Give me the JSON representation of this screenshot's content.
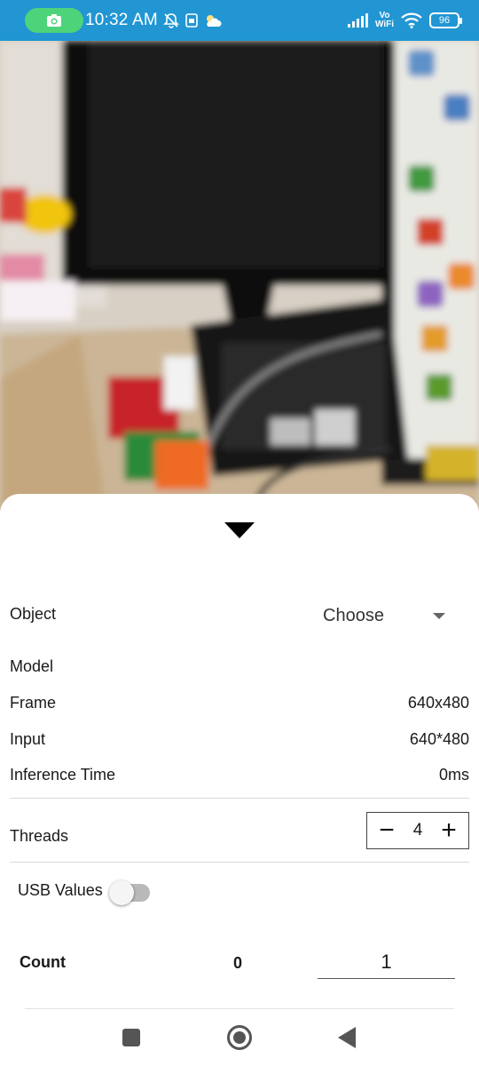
{
  "status_bar": {
    "time": "10:32 AM",
    "network_label": "Vo\nWiFi",
    "battery": "96",
    "icons": [
      "camera-icon",
      "bell-off-icon",
      "sim-icon",
      "weather-icon",
      "signal-icon",
      "wifi-icon",
      "battery-icon"
    ],
    "colors": {
      "bar": "#2196d3",
      "camera_pill": "#4dd37a"
    }
  },
  "sheet": {
    "object_label": "Object",
    "object_selected": "Choose",
    "model_label": "Model",
    "model_value": "",
    "frame_label": "Frame",
    "frame_value": "640x480",
    "input_label": "Input",
    "input_value": "640*480",
    "inference_label": "Inference Time",
    "inference_value": "0ms",
    "threads_label": "Threads",
    "threads_value": "4",
    "minus_glyph": "−",
    "plus_glyph": "+",
    "usb_label": "USB Values",
    "usb_enabled": false,
    "count_label": "Count",
    "count_value": "0",
    "count_input_value": "1"
  },
  "nav": {
    "icons": [
      "recent-apps-icon",
      "home-icon",
      "back-icon"
    ]
  }
}
